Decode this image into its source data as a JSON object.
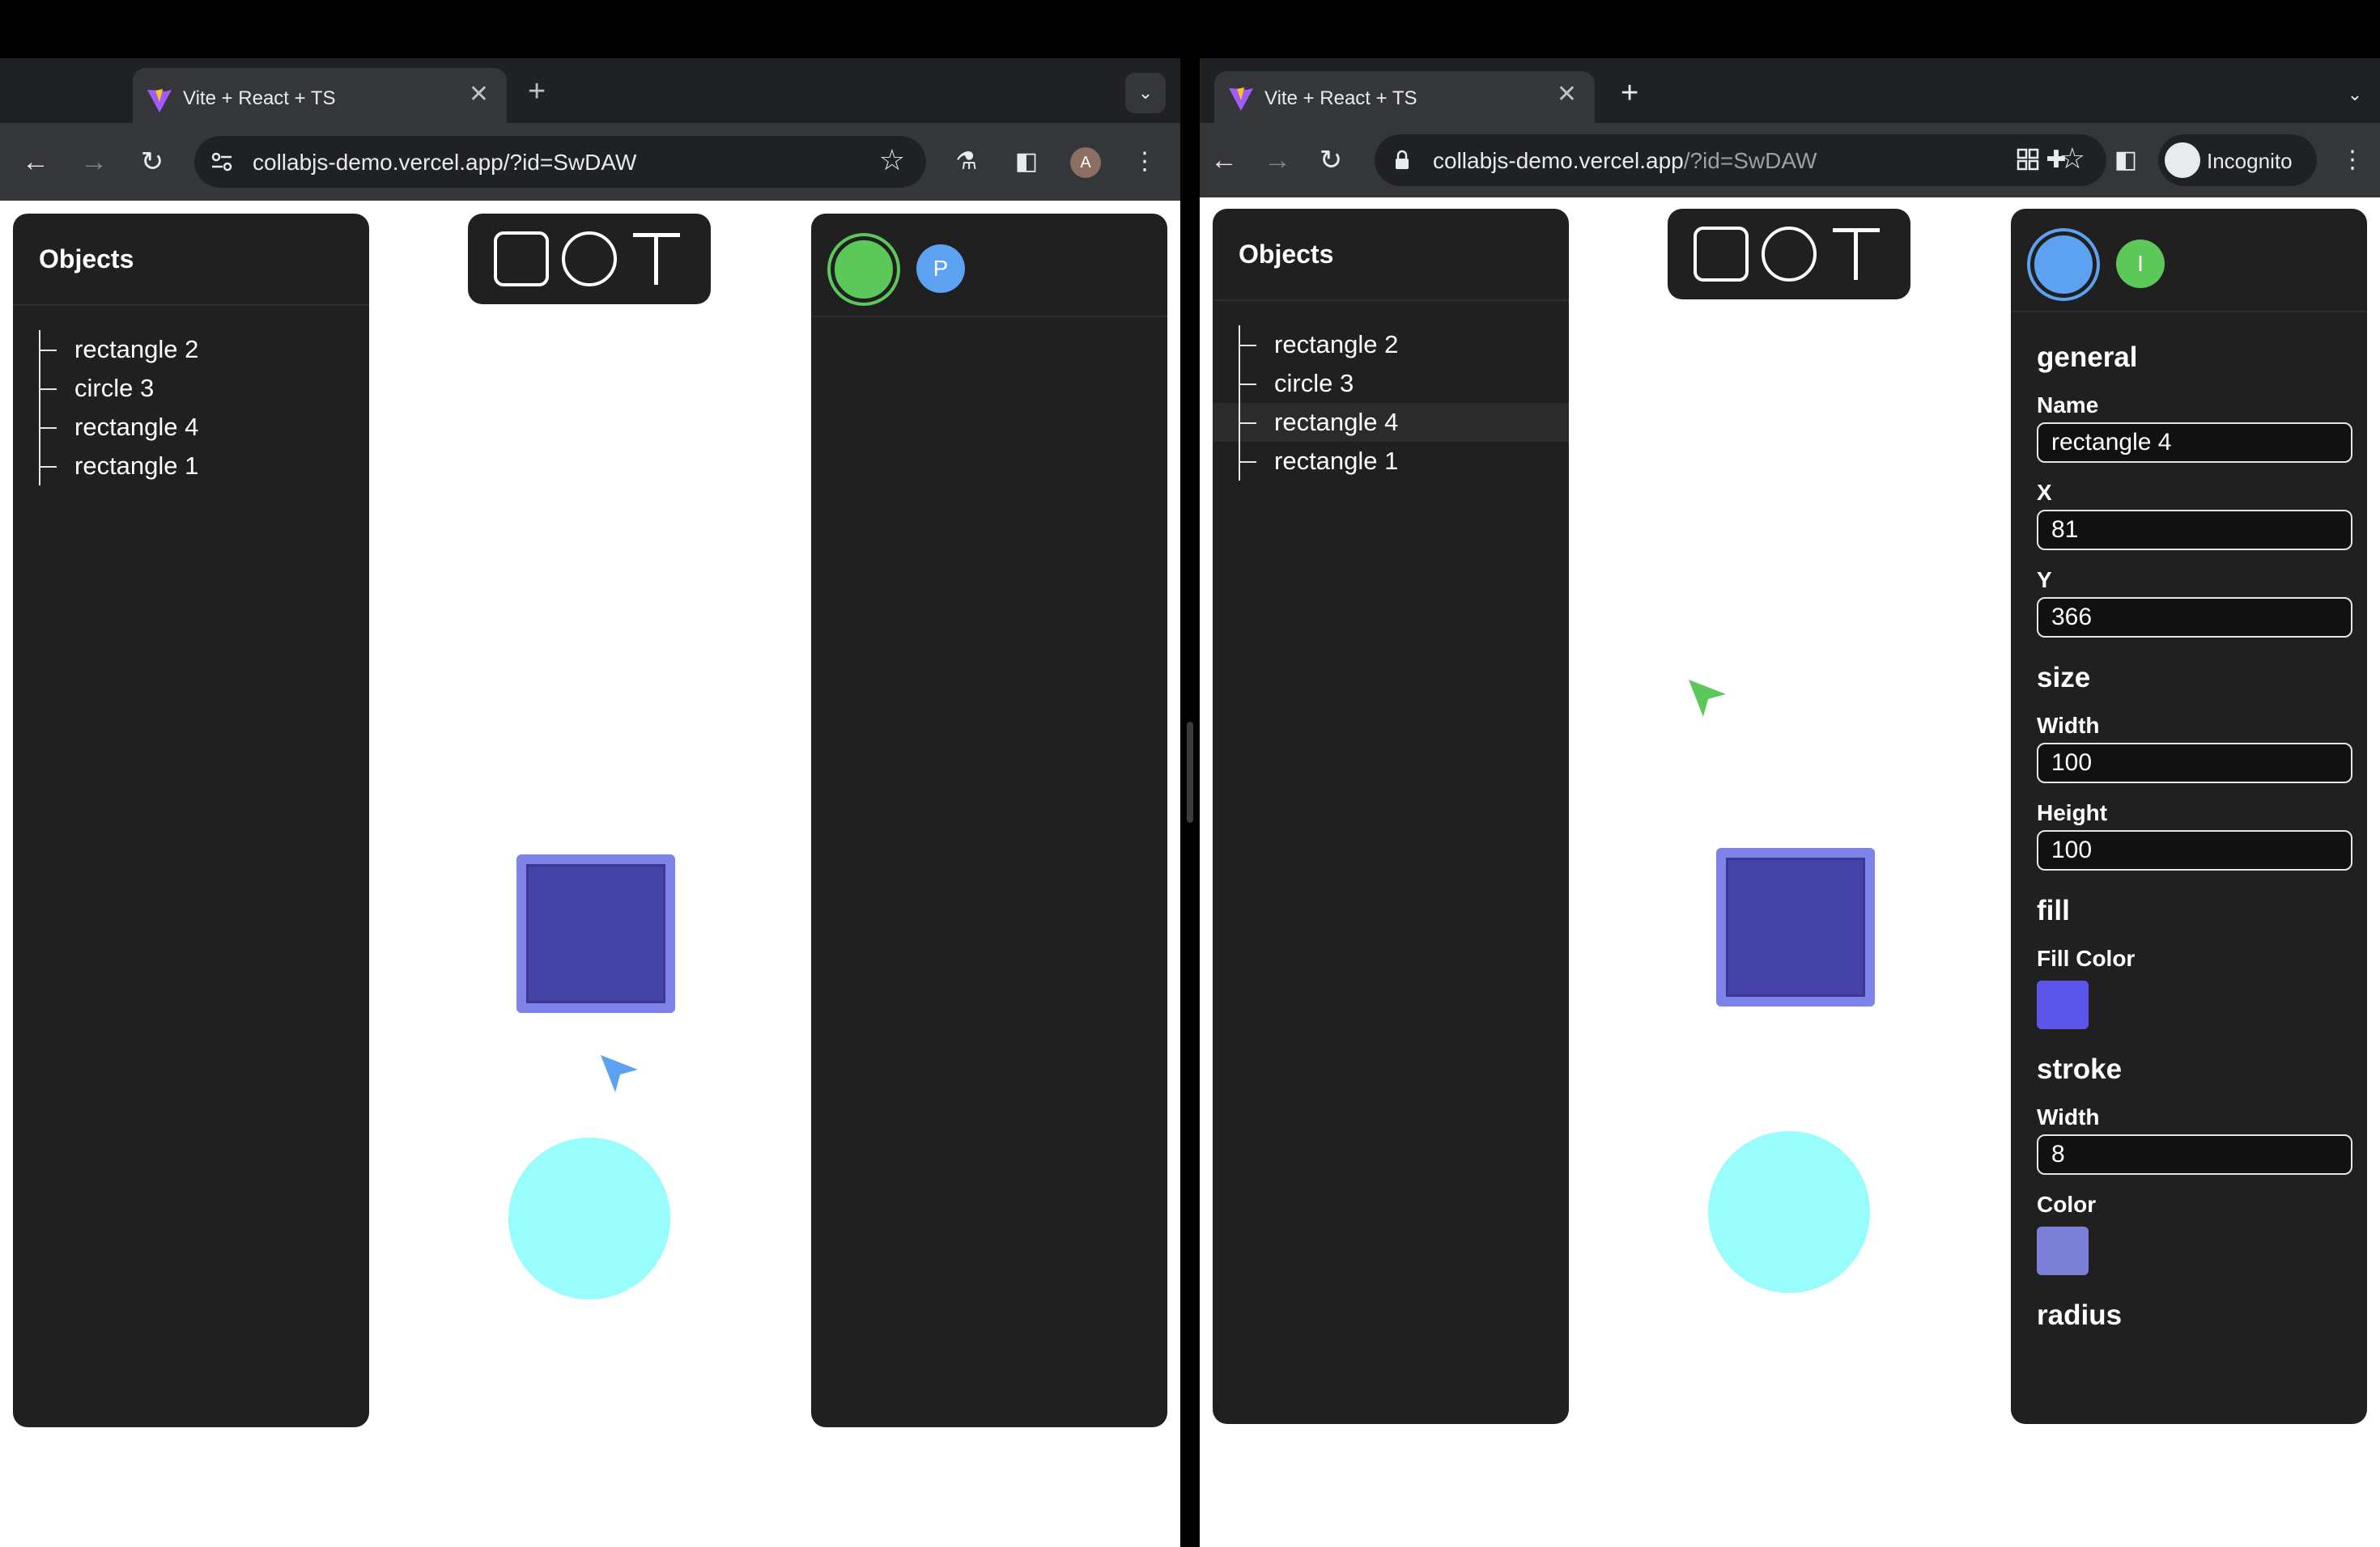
{
  "tab_title": "Vite + React + TS",
  "url_host": "collabjs-demo.vercel.app",
  "url_path": "/?id=SwDAW",
  "incognito_label": "Incognito",
  "profile_initial": "A",
  "objects_title": "Objects",
  "objects": [
    "rectangle 2",
    "circle 3",
    "rectangle 4",
    "rectangle 1"
  ],
  "users_left": [
    "I",
    "P"
  ],
  "users_right": [
    "P",
    "I"
  ],
  "colors": {
    "user_green": "#5cc85a",
    "user_blue": "#5da2f0",
    "fill_color": "#5a55e8",
    "stroke_color": "#7c7fd6",
    "circle_fill": "#99fdfb"
  },
  "properties": {
    "general_label": "general",
    "name_label": "Name",
    "name_value": "rectangle 4",
    "x_label": "X",
    "x_value": "81",
    "y_label": "Y",
    "y_value": "366",
    "size_label": "size",
    "width_label": "Width",
    "width_value": "100",
    "height_label": "Height",
    "height_value": "100",
    "fill_label": "fill",
    "fill_color_label": "Fill Color",
    "stroke_label": "stroke",
    "stroke_width_label": "Width",
    "stroke_width_value": "8",
    "stroke_color_label": "Color",
    "radius_label": "radius"
  },
  "icons": {
    "back": "arrow-left-icon",
    "forward": "arrow-right-icon",
    "reload": "reload-icon",
    "bookmark": "star-icon",
    "close": "close-icon",
    "new_tab": "plus-icon",
    "tab_menu": "chevron-down-icon",
    "labs": "flask-icon",
    "side_panel": "side-panel-icon",
    "menu": "kebab-menu-icon",
    "extensions": "puzzle-icon"
  }
}
